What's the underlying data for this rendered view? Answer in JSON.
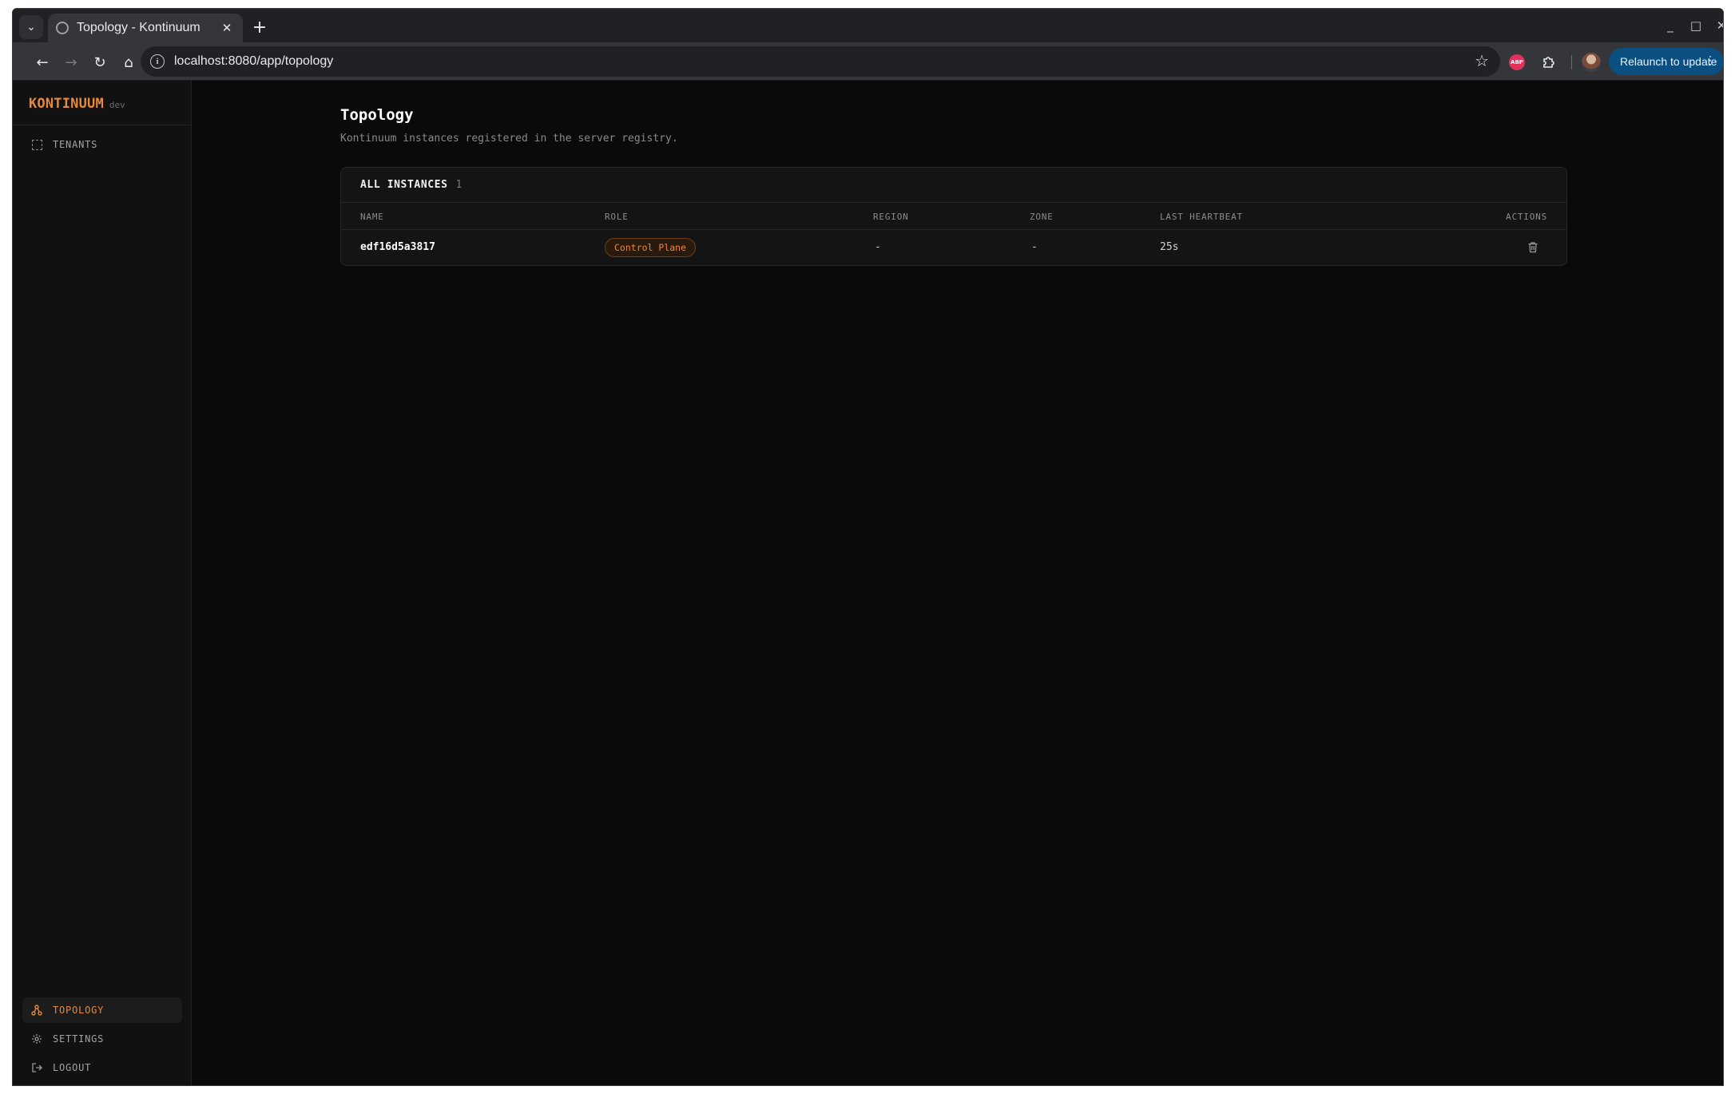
{
  "browser": {
    "tab_title": "Topology - Kontinuum",
    "url": "localhost:8080/app/topology",
    "relaunch_label": "Relaunch to update",
    "abp_label": "ABP"
  },
  "brand": {
    "name": "KONTINUUM",
    "env": "dev"
  },
  "sidebar": {
    "top_items": [
      {
        "label": "TENANTS",
        "icon": "tenants-icon"
      }
    ],
    "bottom_items": [
      {
        "label": "TOPOLOGY",
        "icon": "topology-icon",
        "active": true
      },
      {
        "label": "SETTINGS",
        "icon": "gear-icon"
      },
      {
        "label": "LOGOUT",
        "icon": "logout-icon"
      }
    ]
  },
  "page": {
    "title": "Topology",
    "subtitle": "Kontinuum instances registered in the server registry."
  },
  "instances": {
    "title": "ALL INSTANCES",
    "count": "1",
    "columns": [
      "NAME",
      "ROLE",
      "REGION",
      "ZONE",
      "LAST HEARTBEAT",
      "ACTIONS"
    ],
    "rows": [
      {
        "name": "edf16d5a3817",
        "role": "Control Plane",
        "region": "-",
        "zone": "-",
        "last_heartbeat": "25s"
      }
    ]
  },
  "colors": {
    "accent": "#e8883a",
    "background": "#0a0a0a",
    "sidebar": "#111111",
    "card": "#141414",
    "relaunch": "#0b4f80"
  }
}
